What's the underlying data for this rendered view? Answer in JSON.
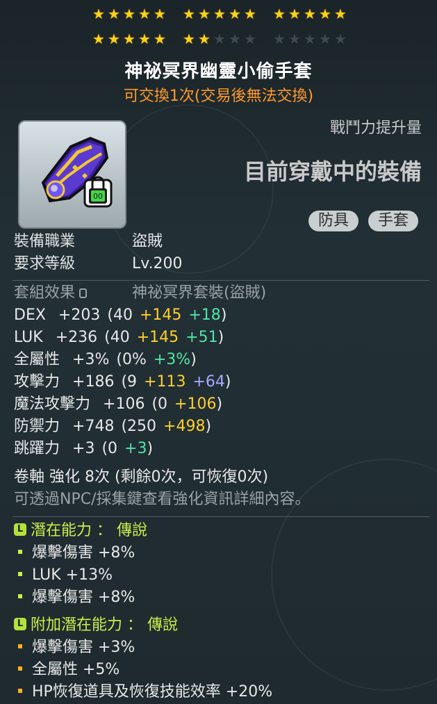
{
  "stars": {
    "group1": {
      "filled": 5,
      "total": 5
    },
    "group2": {
      "filled": 5,
      "total": 5
    },
    "group3": {
      "filled": 5,
      "total": 5
    },
    "group4": {
      "filled": 5,
      "total": 5
    },
    "group5": {
      "filled": 2,
      "total": 5
    },
    "group6": {
      "filled": 0,
      "total": 5
    }
  },
  "item": {
    "name": "神祕冥界幽靈小偷手套",
    "trade_info": "可交換1次(交易後無法交換)",
    "icon": "purple-glove-icon"
  },
  "combat_power": {
    "label": "戰鬥力提升量",
    "status": "目前穿戴中的裝備"
  },
  "tags": [
    "防具",
    "手套"
  ],
  "requirements": {
    "job_label": "裝備職業",
    "job_value": "盜賊",
    "level_label": "要求等級",
    "level_value": "Lv.200"
  },
  "set_effect": {
    "label": "套組效果",
    "value": "神祕冥界套裝(盜賊)"
  },
  "stats": [
    {
      "name": "DEX",
      "total": "+203",
      "base": "(40",
      "bonus1": "+145",
      "bonus2": "+18",
      "bonus2_color": "green",
      "close": ")"
    },
    {
      "name": "LUK",
      "total": "+236",
      "base": "(40",
      "bonus1": "+145",
      "bonus2": "+51",
      "bonus2_color": "green",
      "close": ")"
    },
    {
      "name": "全屬性",
      "total": "+3%",
      "base": "(0%",
      "bonus1": "",
      "bonus2": "+3%",
      "bonus2_color": "green",
      "close": ")"
    },
    {
      "name": "攻擊力",
      "total": "+186",
      "base": "(9",
      "bonus1": "+113",
      "bonus2": "+64",
      "bonus2_color": "purple",
      "close": ")"
    },
    {
      "name": "魔法攻擊力",
      "total": "+106",
      "base": "(0",
      "bonus1": "+106",
      "bonus2": "",
      "bonus2_color": "",
      "close": ")"
    },
    {
      "name": "防禦力",
      "total": "+748",
      "base": "(250",
      "bonus1": "+498",
      "bonus2": "",
      "bonus2_color": "",
      "close": ")"
    },
    {
      "name": "跳躍力",
      "total": "+3",
      "base": "(0",
      "bonus1": "",
      "bonus2": "+3",
      "bonus2_color": "green",
      "close": ")"
    }
  ],
  "scroll": {
    "text": "卷軸 強化 8次 (剩餘0次，可恢復0次)",
    "hint": "可透過NPC/採集鍵查看強化資訊詳細內容。"
  },
  "potential": {
    "badge": "L",
    "title": "潛在能力 ： 傳說",
    "lines": [
      "爆擊傷害 +8%",
      "LUK +13%",
      "爆擊傷害 +8%"
    ]
  },
  "additional_potential": {
    "badge": "L",
    "title": "附加潛在能力 ： 傳說",
    "lines": [
      "爆擊傷害 +3%",
      "全屬性 +5%",
      "HP恢復道具及恢復技能效率 +20%"
    ]
  },
  "colors": {
    "star": "#ffd21a",
    "trade": "#ff9a2a",
    "bonus_yellow": "#ffd02a",
    "bonus_green": "#4ee6a6",
    "bonus_purple": "#a9a8ff",
    "legend": "#c8f04a"
  }
}
